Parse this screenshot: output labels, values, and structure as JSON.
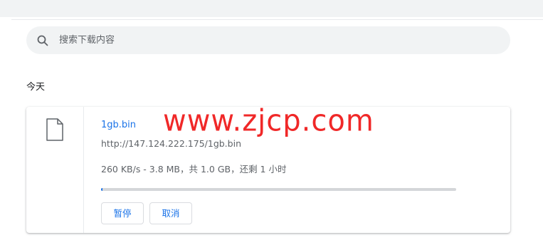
{
  "search": {
    "placeholder": "搜索下载内容"
  },
  "section": {
    "date_heading": "今天"
  },
  "download": {
    "file_name": "1gb.bin",
    "url": "http://147.124.222.175/1gb.bin",
    "status": "260 KB/s - 3.8 MB，共 1.0 GB，还剩 1 小时",
    "progress_fraction": 0.004,
    "pause_label": "暂停",
    "cancel_label": "取消"
  },
  "watermark": {
    "text": "www.zjcp.com"
  },
  "colors": {
    "accent": "#1a73e8",
    "watermark": "#f02828",
    "progress_track": "#d4d6d9"
  }
}
